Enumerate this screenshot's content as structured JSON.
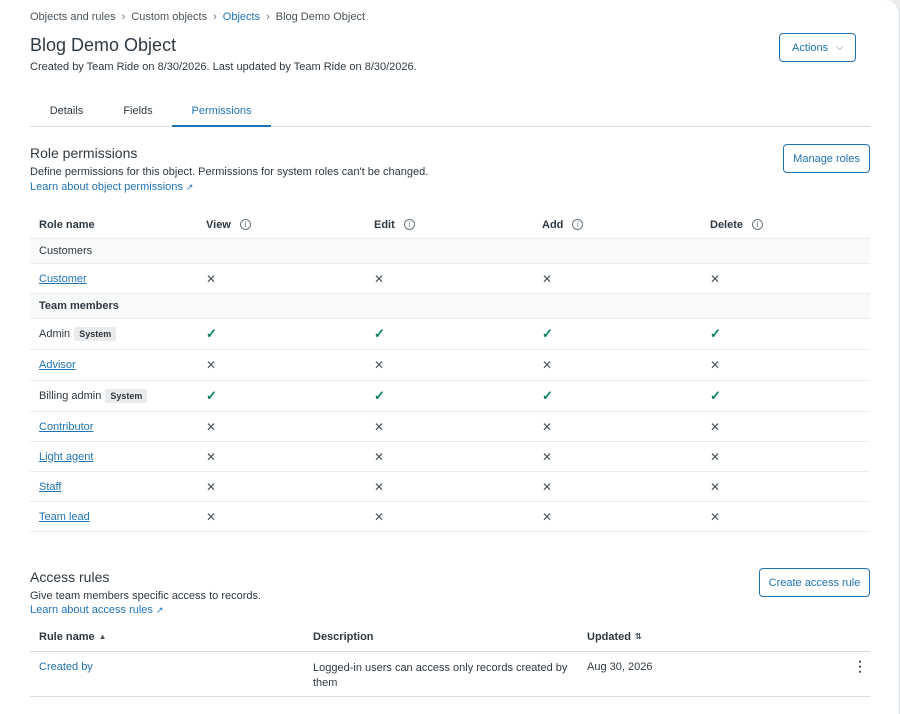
{
  "breadcrumb": {
    "items": [
      "Objects and rules",
      "Custom objects",
      "Objects",
      "Blog Demo Object"
    ]
  },
  "header": {
    "title": "Blog Demo Object",
    "subtitle": "Created by Team Ride on 8/30/2026. Last updated by Team Ride on 8/30/2026.",
    "actions_label": "Actions"
  },
  "tabs": [
    {
      "label": "Details"
    },
    {
      "label": "Fields"
    },
    {
      "label": "Permissions"
    }
  ],
  "role_permissions": {
    "title": "Role permissions",
    "description": "Define permissions for this object. Permissions for system roles can't be changed.",
    "learn_link": "Learn about object permissions",
    "manage_label": "Manage roles",
    "columns": [
      "Role name",
      "View",
      "Edit",
      "Add",
      "Delete"
    ],
    "groups": [
      {
        "label": "Customers"
      },
      {
        "label": "Team members"
      }
    ],
    "rows": [
      {
        "name": "Customer",
        "badge": ""
      },
      {
        "name": "Admin",
        "badge": "System"
      },
      {
        "name": "Advisor",
        "badge": ""
      },
      {
        "name": "Billing admin",
        "badge": "System"
      },
      {
        "name": "Contributor",
        "badge": ""
      },
      {
        "name": "Light agent",
        "badge": ""
      },
      {
        "name": "Staff",
        "badge": ""
      },
      {
        "name": "Team lead",
        "badge": ""
      }
    ],
    "permissions": [
      {
        "view": false,
        "edit": false,
        "add": false,
        "delete": false
      },
      {
        "view": true,
        "edit": true,
        "add": true,
        "delete": true
      },
      {
        "view": false,
        "edit": false,
        "add": false,
        "delete": false
      },
      {
        "view": true,
        "edit": true,
        "add": true,
        "delete": true
      },
      {
        "view": false,
        "edit": false,
        "add": false,
        "delete": false
      },
      {
        "view": false,
        "edit": false,
        "add": false,
        "delete": false
      },
      {
        "view": false,
        "edit": false,
        "add": false,
        "delete": false
      },
      {
        "view": false,
        "edit": false,
        "add": false,
        "delete": false
      }
    ],
    "icons": {
      "allowed": "check-icon",
      "denied": "x-icon",
      "info": "info-icon"
    }
  },
  "access_rules": {
    "title": "Access rules",
    "description": "Give team members specific access to records.",
    "learn_link": "Learn about access rules",
    "create_label": "Create access rule",
    "columns": [
      "Rule name",
      "Description",
      "Updated"
    ],
    "rows": [
      {
        "name": "Created by",
        "description_line1": "Logged-in users can access only records created by",
        "description_line2": "them",
        "updated": "Aug 30, 2026"
      }
    ]
  },
  "colors": {
    "accent": "#1f73b7",
    "check": "#038153",
    "text": "#2f3941"
  }
}
